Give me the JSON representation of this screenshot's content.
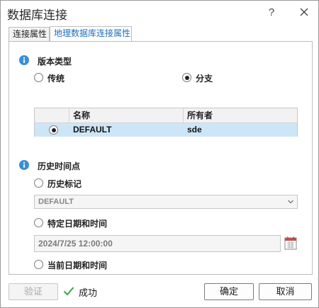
{
  "window": {
    "title": "数据库连接",
    "help_label": "?"
  },
  "tabs": [
    {
      "label": "连接属性",
      "active": false
    },
    {
      "label": "地理数据库连接属性",
      "active": true
    }
  ],
  "version_type": {
    "section_label": "版本类型",
    "options": [
      {
        "label": "传统",
        "checked": false
      },
      {
        "label": "分支",
        "checked": true
      }
    ]
  },
  "version_table": {
    "columns": [
      "名称",
      "所有者"
    ],
    "rows": [
      {
        "name": "DEFAULT",
        "owner": "sde",
        "selected": true
      }
    ]
  },
  "historical_moment": {
    "section_label": "历史时间点",
    "options": [
      {
        "label": "历史标记",
        "checked": false
      },
      {
        "label": "特定日期和时间",
        "checked": false
      },
      {
        "label": "当前日期和时间",
        "checked": false
      }
    ],
    "marker_value": "DEFAULT",
    "datetime_value": "2024/7/25 12:00:00"
  },
  "footer": {
    "validate_label": "验证",
    "status_text": "成功",
    "ok_label": "确定",
    "cancel_label": "取消"
  },
  "colors": {
    "accent": "#1e6fbf",
    "info_icon": "#3a8fd6",
    "selected_row": "#cde6f7",
    "success": "#3aa34a"
  }
}
